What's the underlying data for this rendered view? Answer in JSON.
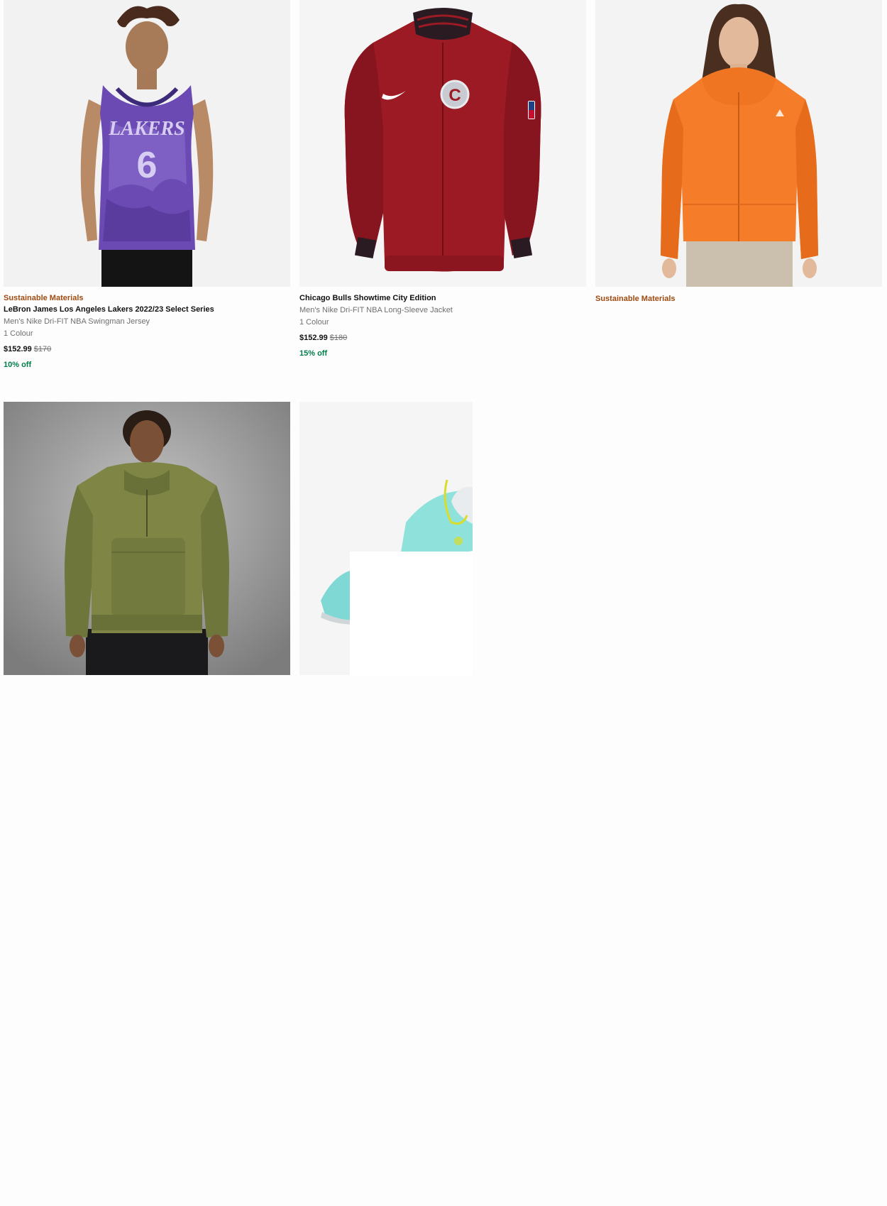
{
  "products": [
    {
      "badge": "Sustainable Materials",
      "title": "LeBron James Los Angeles Lakers 2022/23 Select Series",
      "subtitle": "Men's Nike Dri-FIT NBA Swingman Jersey",
      "colours": "1 Colour",
      "price": "$152.99",
      "original_price": "$170",
      "discount": "10% off",
      "image_icon": "jersey-icon",
      "jersey_text": "LAKERS",
      "jersey_number": "6"
    },
    {
      "badge": "",
      "title": "Chicago Bulls Showtime City Edition",
      "subtitle": "Men's Nike Dri-FIT NBA Long-Sleeve Jacket",
      "colours": "1 Colour",
      "price": "$152.99",
      "original_price": "$180",
      "discount": "15% off",
      "image_icon": "jacket-icon",
      "patch_letter": "C"
    },
    {
      "badge": "Sustainable Materials",
      "image_icon": "rain-jacket-icon"
    },
    {
      "image_icon": "hoodie-icon"
    },
    {
      "image_icon": "shoe-icon"
    }
  ],
  "colors": {
    "badge": "#9e4a11",
    "discount": "#007d48",
    "muted": "#707072",
    "text": "#111111"
  }
}
